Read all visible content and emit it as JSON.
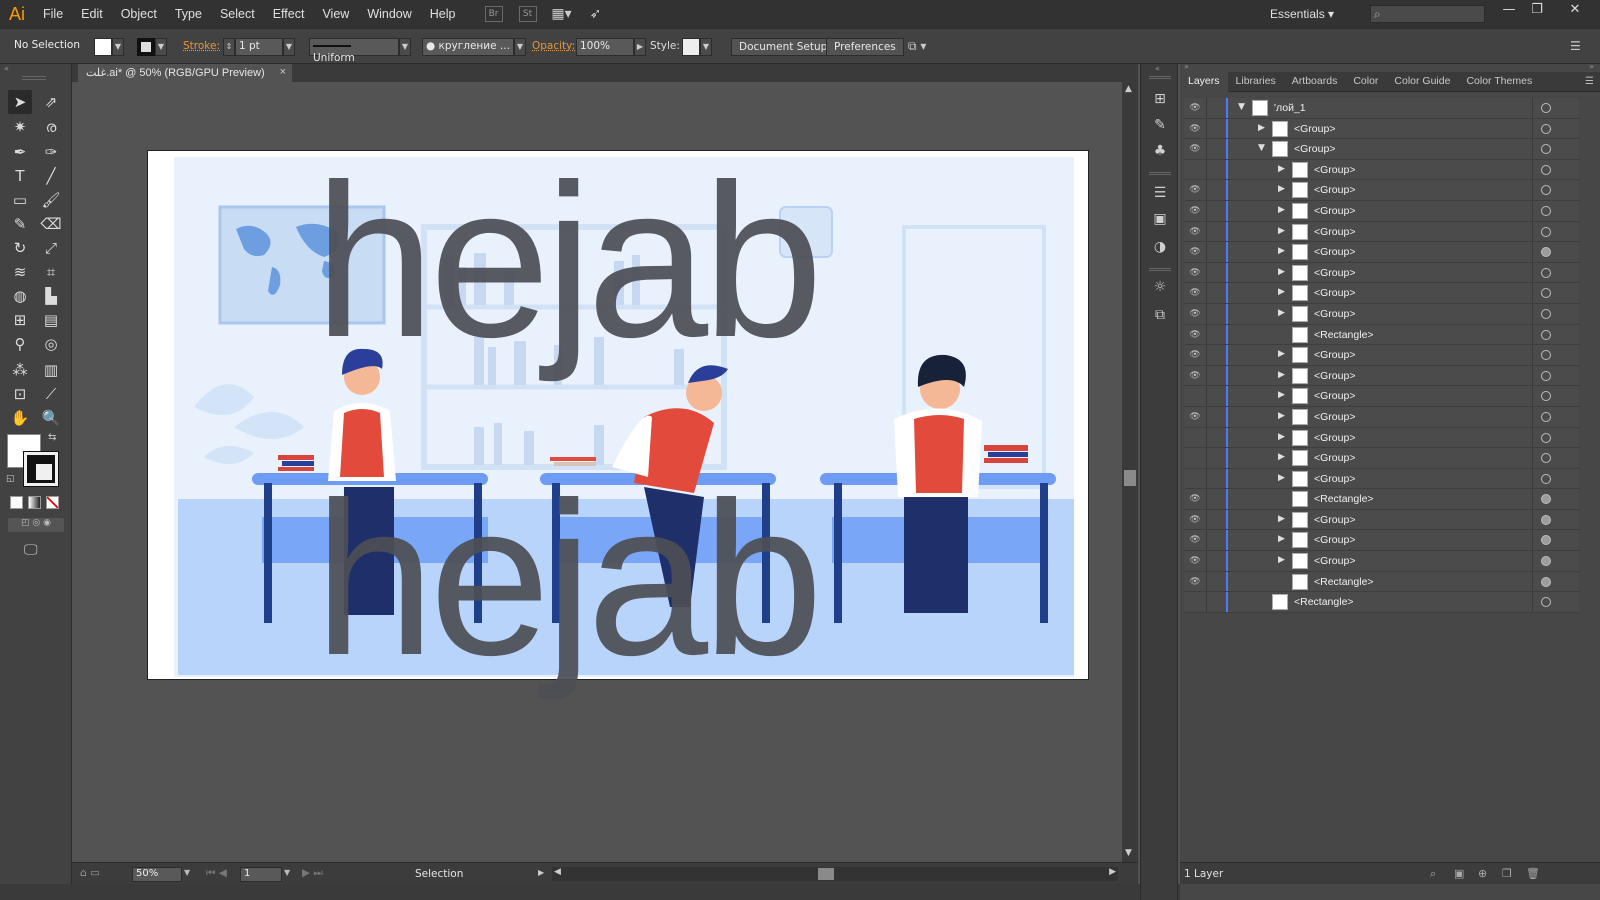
{
  "app": {
    "logo": "Ai"
  },
  "menu": [
    "File",
    "Edit",
    "Object",
    "Type",
    "Select",
    "Effect",
    "View",
    "Window",
    "Help"
  ],
  "menubar_icons": {
    "bridge": "Br",
    "stock": "St"
  },
  "workspace": "Essentials",
  "control": {
    "selection": "No Selection",
    "stroke_label": "Stroke:",
    "stroke_weight": "1 pt",
    "profile": "Uniform",
    "brush": "кругление ...",
    "opacity_label": "Opacity:",
    "opacity": "100%",
    "style_label": "Style:",
    "document_setup": "Document Setup",
    "preferences": "Preferences"
  },
  "document": {
    "tab_title": "غلت.ai* @ 50% (RGB/GPU Preview)",
    "close": "×"
  },
  "artwork": {
    "text_top": "hejab",
    "text_bottom": "hejab"
  },
  "status": {
    "zoom": "50%",
    "page": "1",
    "tool": "Selection"
  },
  "panel_tabs": [
    "Layers",
    "Libraries",
    "Artboards",
    "Color",
    "Color Guide",
    "Color Themes"
  ],
  "layers": [
    {
      "name": "'лой_1",
      "level": 0,
      "expand": "down",
      "eye": true,
      "target_filled": false
    },
    {
      "name": "<Group>",
      "level": 1,
      "expand": "right",
      "eye": true,
      "target_filled": false
    },
    {
      "name": "<Group>",
      "level": 1,
      "expand": "down",
      "eye": true,
      "target_filled": false
    },
    {
      "name": "<Group>",
      "level": 2,
      "expand": "right",
      "eye": false,
      "target_filled": false
    },
    {
      "name": "<Group>",
      "level": 2,
      "expand": "right",
      "eye": true,
      "target_filled": false
    },
    {
      "name": "<Group>",
      "level": 2,
      "expand": "right",
      "eye": true,
      "target_filled": false
    },
    {
      "name": "<Group>",
      "level": 2,
      "expand": "right",
      "eye": true,
      "target_filled": false
    },
    {
      "name": "<Group>",
      "level": 2,
      "expand": "right",
      "eye": true,
      "target_filled": true
    },
    {
      "name": "<Group>",
      "level": 2,
      "expand": "right",
      "eye": true,
      "target_filled": false
    },
    {
      "name": "<Group>",
      "level": 2,
      "expand": "right",
      "eye": true,
      "target_filled": false
    },
    {
      "name": "<Group>",
      "level": 2,
      "expand": "right",
      "eye": true,
      "target_filled": false
    },
    {
      "name": "<Rectangle>",
      "level": 2,
      "expand": "none",
      "eye": true,
      "target_filled": false
    },
    {
      "name": "<Group>",
      "level": 2,
      "expand": "right",
      "eye": true,
      "target_filled": false
    },
    {
      "name": "<Group>",
      "level": 2,
      "expand": "right",
      "eye": true,
      "target_filled": false
    },
    {
      "name": "<Group>",
      "level": 2,
      "expand": "right",
      "eye": false,
      "target_filled": false
    },
    {
      "name": "<Group>",
      "level": 2,
      "expand": "right",
      "eye": true,
      "target_filled": false
    },
    {
      "name": "<Group>",
      "level": 2,
      "expand": "right",
      "eye": false,
      "target_filled": false
    },
    {
      "name": "<Group>",
      "level": 2,
      "expand": "right",
      "eye": false,
      "target_filled": false
    },
    {
      "name": "<Group>",
      "level": 2,
      "expand": "right",
      "eye": false,
      "target_filled": false
    },
    {
      "name": "<Rectangle>",
      "level": 2,
      "expand": "none",
      "eye": true,
      "target_filled": true
    },
    {
      "name": "<Group>",
      "level": 2,
      "expand": "right",
      "eye": true,
      "target_filled": true
    },
    {
      "name": "<Group>",
      "level": 2,
      "expand": "right",
      "eye": true,
      "target_filled": true
    },
    {
      "name": "<Group>",
      "level": 2,
      "expand": "right",
      "eye": true,
      "target_filled": true
    },
    {
      "name": "<Rectangle>",
      "level": 2,
      "expand": "none",
      "eye": true,
      "target_filled": true
    },
    {
      "name": "<Rectangle>",
      "level": 1,
      "expand": "none",
      "eye": false,
      "target_filled": false
    }
  ],
  "layers_footer": {
    "count": "1 Layer"
  },
  "colors": {
    "accent_orange": "#ff9a00",
    "layer_bar": "#4f78ff",
    "canvas": "#535353"
  }
}
